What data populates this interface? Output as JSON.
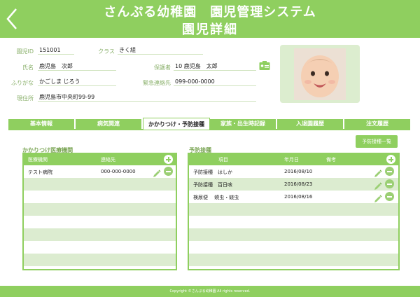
{
  "header": {
    "title": "さんぷる幼稚園　園児管理システム",
    "subtitle": "園児詳細"
  },
  "info": {
    "id_label": "園児ID",
    "id_value": "151001",
    "class_label": "クラス",
    "class_value": "きく組",
    "name_label": "氏名",
    "name_value": "鹿児島　次郎",
    "guardian_label": "保護者",
    "guardian_value": "10 鹿児島　太郎",
    "kana_label": "ふりがな",
    "kana_value": "かごしま じろう",
    "emergency_label": "緊急連絡先",
    "emergency_value": "099-000-0000",
    "address_label": "現住所",
    "address_value": "鹿児島市中央町99-99"
  },
  "tabs": [
    {
      "label": "基本情報"
    },
    {
      "label": "病気関連"
    },
    {
      "label": "かかりつけ・予防接種"
    },
    {
      "label": "家族・出生時記録"
    },
    {
      "label": "入退園履歴"
    },
    {
      "label": "注文履歴"
    }
  ],
  "clinic": {
    "title": "かかりつけ医療機関",
    "col_name": "医療機関",
    "col_contact": "連絡先",
    "rows": [
      {
        "name": "テスト病院",
        "contact": "000-000-0000"
      }
    ]
  },
  "vaccine": {
    "title": "予防接種",
    "list_button": "予防接種一覧",
    "col_item": "項目",
    "col_date": "年月日",
    "col_note": "備考",
    "rows": [
      {
        "item": "予防接種　はしか",
        "date": "2016/08/10"
      },
      {
        "item": "予防接種　百日咳",
        "date": "2016/08/23"
      },
      {
        "item": "検尿便　 蟯虫・蛲虫",
        "date": "2016/08/16"
      }
    ]
  },
  "footer": {
    "copyright": "Copyright ©さんぷる幼稚園 All rights reserved."
  },
  "colors": {
    "accent": "#8fcf5f",
    "row_alt": "#dcecd0",
    "label": "#8ab06b"
  }
}
